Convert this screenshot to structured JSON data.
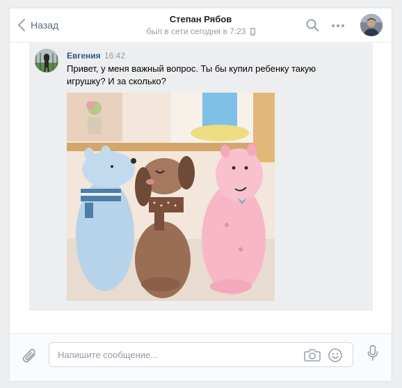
{
  "header": {
    "back_label": "Назад",
    "peer_name": "Степан Рябов",
    "peer_status": "был в сети сегодня в 7:23",
    "icons": [
      "chevron-left-icon",
      "mobile-icon",
      "search-icon",
      "more-icon"
    ]
  },
  "message": {
    "author": "Евгения",
    "time": "16:42",
    "text": "Привет, у меня важный вопрос. Ты бы купил ребенку такую игрушку? И за сколько?",
    "attachment": "photo"
  },
  "composer": {
    "placeholder": "Напишите сообщение...",
    "icons": [
      "paperclip-icon",
      "camera-icon",
      "smile-icon",
      "microphone-icon"
    ]
  },
  "colors": {
    "accent": "#2a5885",
    "muted": "#939aa6",
    "background": "#edeef0",
    "icon": "#99a2ad"
  }
}
